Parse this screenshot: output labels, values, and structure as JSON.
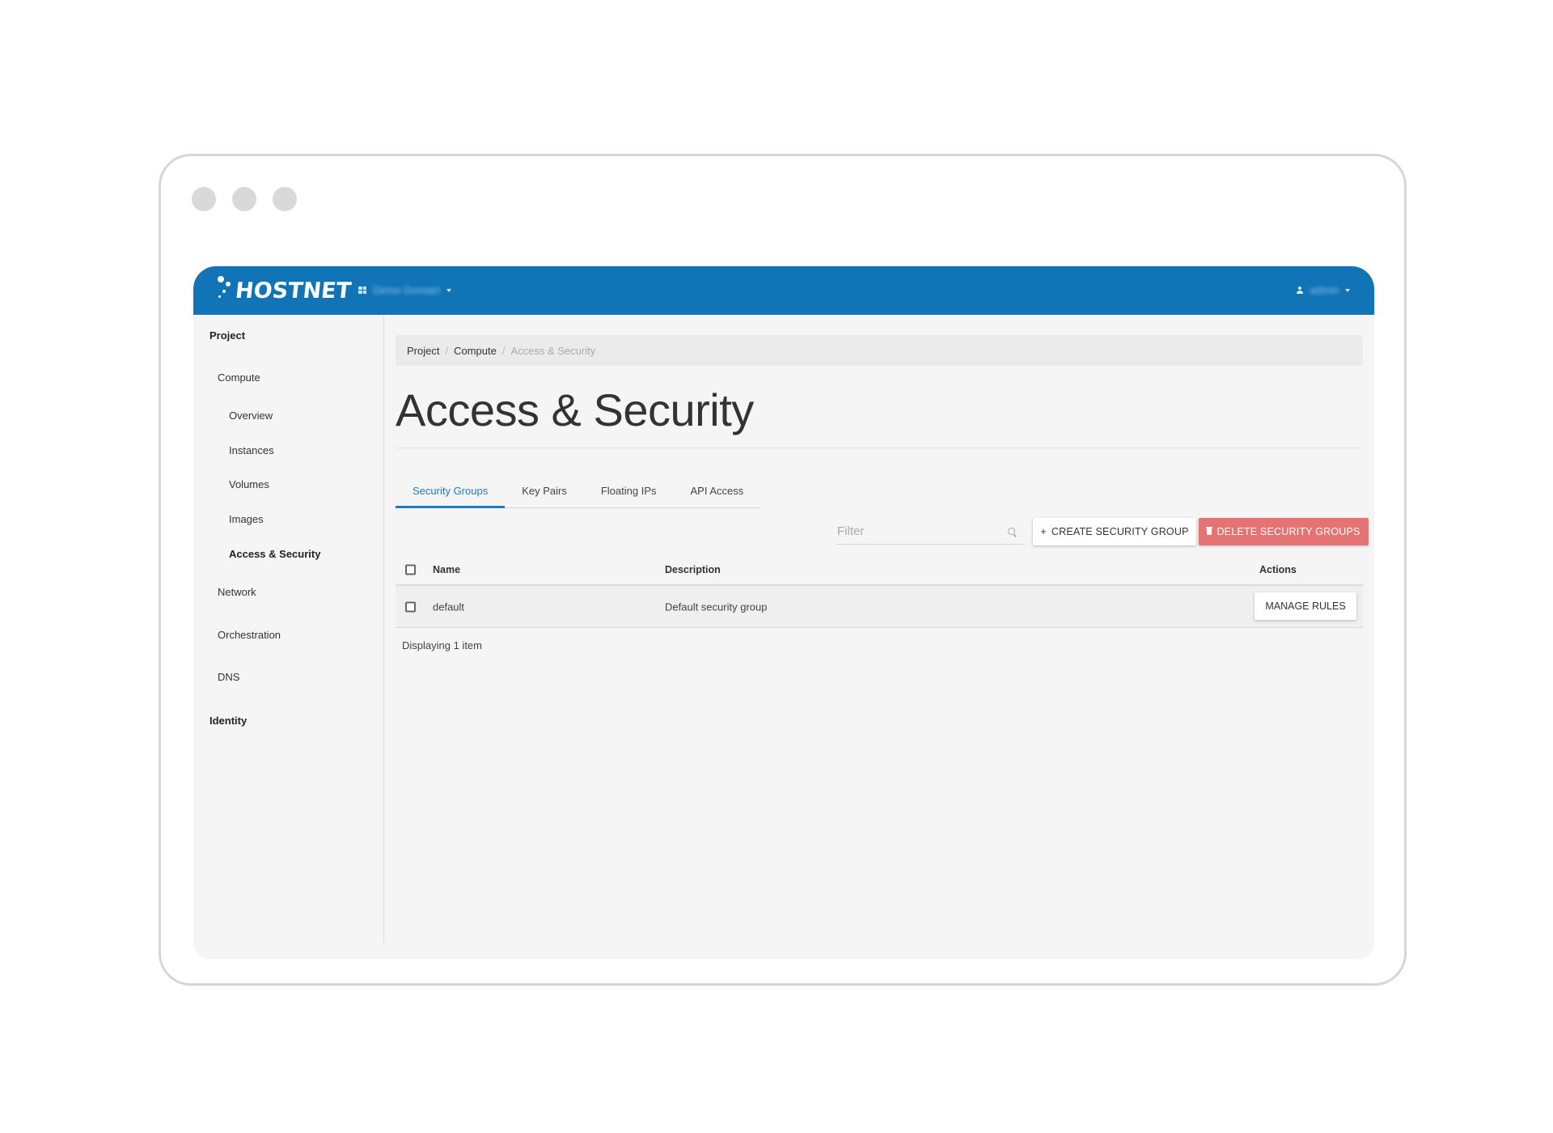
{
  "brand": {
    "name": "HOSTNET"
  },
  "navbar": {
    "project_label": "Demo Domain",
    "user_label": "admin"
  },
  "sidebar": {
    "project": "Project",
    "compute": "Compute",
    "items": [
      "Overview",
      "Instances",
      "Volumes",
      "Images",
      "Access & Security"
    ],
    "network": "Network",
    "orchestration": "Orchestration",
    "dns": "DNS",
    "identity": "Identity"
  },
  "breadcrumb": {
    "items": [
      "Project",
      "Compute"
    ],
    "current": "Access & Security",
    "separator": "/"
  },
  "page": {
    "title": "Access & Security"
  },
  "tabs": [
    {
      "label": "Security Groups",
      "active": true
    },
    {
      "label": "Key Pairs",
      "active": false
    },
    {
      "label": "Floating IPs",
      "active": false
    },
    {
      "label": "API Access",
      "active": false
    }
  ],
  "toolbar": {
    "filter_placeholder": "Filter",
    "create_label": "CREATE SECURITY GROUP",
    "create_icon": "+",
    "delete_label": "DELETE SECURITY GROUPS"
  },
  "table": {
    "columns": {
      "name": "Name",
      "description": "Description",
      "actions": "Actions"
    },
    "rows": [
      {
        "name": "default",
        "description": "Default security group",
        "action": "MANAGE RULES"
      }
    ],
    "footer": "Displaying 1 item"
  },
  "colors": {
    "navbar": "#1174b7",
    "accent": "#1c7bc1",
    "danger": "#e57373"
  }
}
